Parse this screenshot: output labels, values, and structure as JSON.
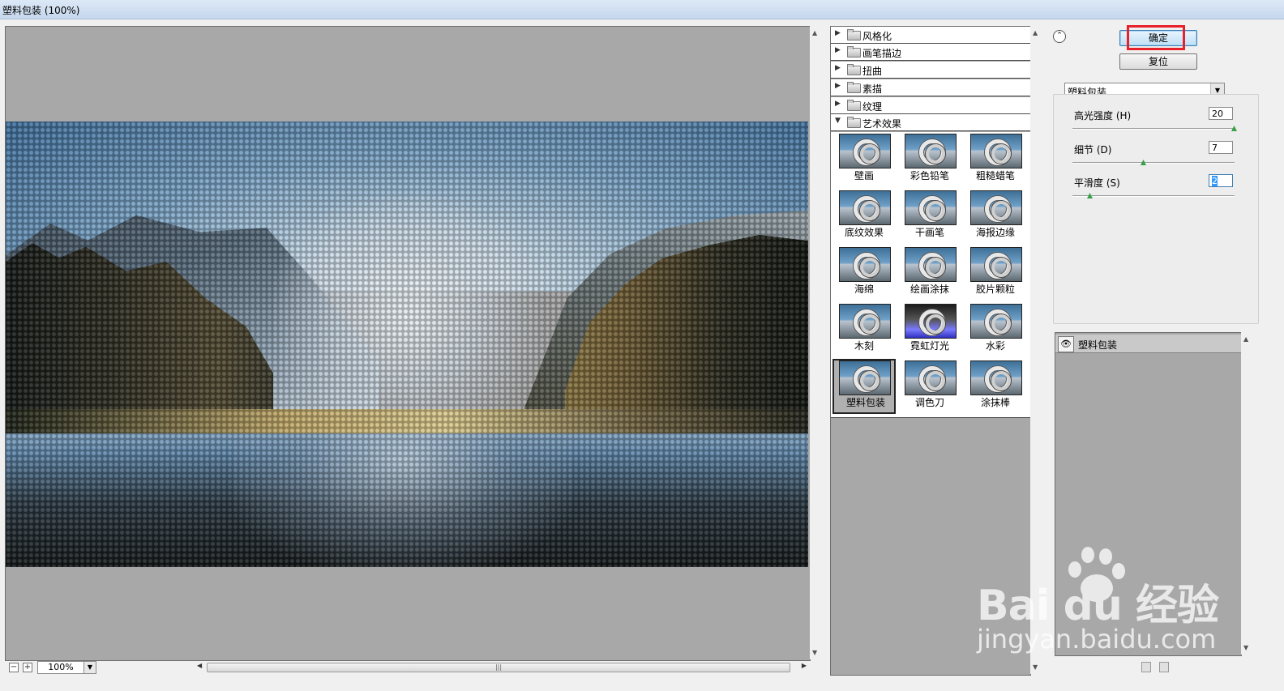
{
  "window": {
    "title": "塑料包装 (100%)"
  },
  "preview": {
    "zoom": "100%"
  },
  "gallery": {
    "categories": [
      {
        "label": "风格化",
        "expanded": false
      },
      {
        "label": "画笔描边",
        "expanded": false
      },
      {
        "label": "扭曲",
        "expanded": false
      },
      {
        "label": "素描",
        "expanded": false
      },
      {
        "label": "纹理",
        "expanded": false
      },
      {
        "label": "艺术效果",
        "expanded": true
      }
    ],
    "effects": [
      "壁画",
      "彩色铅笔",
      "粗糙蜡笔",
      "底纹效果",
      "干画笔",
      "海报边缘",
      "海绵",
      "绘画涂抹",
      "胶片颗粒",
      "木刻",
      "霓虹灯光",
      "水彩",
      "塑料包装",
      "调色刀",
      "涂抹棒"
    ],
    "selected_effect": "塑料包装"
  },
  "buttons": {
    "ok": "确定",
    "reset": "复位"
  },
  "filter_select": {
    "value": "塑料包装"
  },
  "params": [
    {
      "label": "高光强度 (H)",
      "value": "20",
      "level": 1.0
    },
    {
      "label": "细节 (D)",
      "value": "7",
      "level": 0.47
    },
    {
      "label": "平滑度 (S)",
      "value": "2",
      "level": 0.1
    }
  ],
  "layers": [
    {
      "label": "塑料包装",
      "visible": true
    }
  ],
  "watermark": {
    "brand": "Bai du 经验",
    "url": "jingyan.baidu.com"
  },
  "colors": {
    "highlight_box": "#e8202a",
    "knob": "#35a045",
    "panel_gray": "#a8a8a8"
  }
}
